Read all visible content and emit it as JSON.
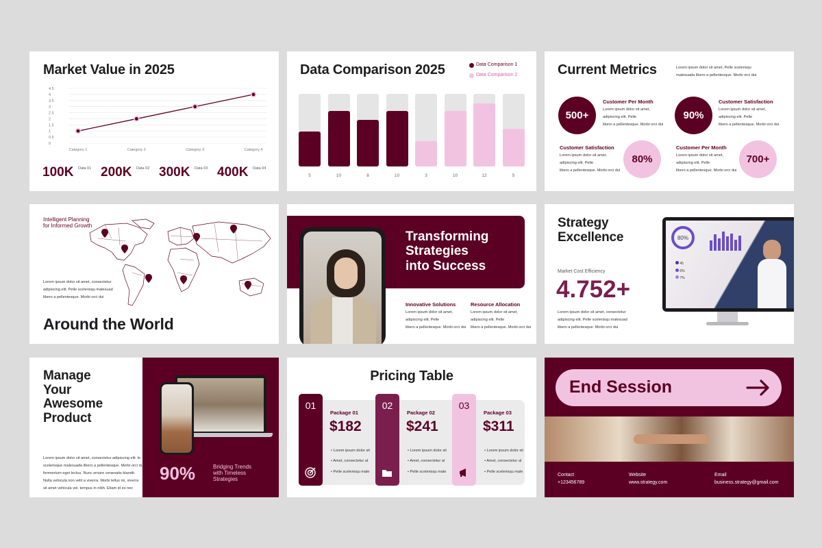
{
  "colors": {
    "wine": "#5b0022",
    "pink": "#f1c3e1",
    "gray_bar": "#e5e5e6",
    "plum": "#7a1e4e",
    "background": "#dcdcdc"
  },
  "lorem": {
    "a": "Lorem ipsum dolor sit amet, consectetur",
    "b": "adipiscing elit. Pelle scelerisqu malesuad",
    "c": "libero a pellentesque. Morbi orci dui",
    "short1": "Lorem ipsum dolor sit amet,",
    "short2": "adipiscing elit. Pelle",
    "short3": "scelerisque malesuada",
    "short4": "libero a pellentesque. Morbi orci dui"
  },
  "slide1": {
    "title": "Market Value in 2025",
    "chart_data": {
      "type": "line",
      "categories": [
        "Category 1",
        "Category 2",
        "Category 3",
        "Category 4"
      ],
      "values": [
        1,
        2,
        3,
        4
      ],
      "ylim": [
        0,
        4.5
      ],
      "yticks": [
        "0",
        "0.5",
        "1",
        "1.5",
        "2",
        "2.5",
        "3",
        "3.5",
        "4",
        "4.5"
      ],
      "grid": true,
      "color": "#5b0022",
      "marker_color": "#f1c3e1"
    },
    "stats": [
      {
        "value": "100K",
        "label": "Data 01"
      },
      {
        "value": "200K",
        "label": "Data 02"
      },
      {
        "value": "300K",
        "label": "Data 03"
      },
      {
        "value": "400K",
        "label": "Data 04"
      }
    ]
  },
  "slide2": {
    "title": "Data Comparison 2025",
    "legend": [
      "Data Comparison 1",
      "Data Comparison 2"
    ],
    "chart_data": {
      "type": "bar",
      "categories": [
        "5",
        "10",
        "8",
        "10",
        "3",
        "10",
        "12",
        "5"
      ],
      "series": [
        {
          "name": "Data Comparison 1",
          "indices": [
            0,
            1,
            2,
            3
          ],
          "color": "#5b0022"
        },
        {
          "name": "Data Comparison 2",
          "indices": [
            4,
            5,
            6,
            7
          ],
          "color": "#f1c3e1"
        }
      ],
      "fill_fraction": [
        0.48,
        0.76,
        0.64,
        0.76,
        0.35,
        0.76,
        0.87,
        0.52
      ],
      "track_color": "#e5e5e6"
    }
  },
  "slide3": {
    "title": "Current Metrics",
    "intro": [
      "Lorem ipsum dolor sit amet, Pelle scelerisqu",
      "malesuada libero a pellentesque. Morbi orci dui"
    ],
    "metrics": [
      {
        "value": "500+",
        "label": "Customer Per Month"
      },
      {
        "value": "90%",
        "label": "Customer Satisfaction"
      },
      {
        "value": "80%",
        "label": "Customer Satisfaction"
      },
      {
        "value": "700+",
        "label": "Customer Per Month"
      }
    ]
  },
  "slide4": {
    "tagline": [
      "Intelligent Planning",
      "for Informed Growth"
    ],
    "title": "Around the World",
    "pin_icon": "map-pin-icon"
  },
  "slide5": {
    "headline": [
      "Transforming",
      "Strategies",
      "into Success"
    ],
    "col1_title": "Innovative Solutions",
    "col2_title": "Resource Allocation"
  },
  "slide6": {
    "title": [
      "Strategy",
      "Excellence"
    ],
    "stat_label": "Market Cost Efficiency",
    "stat_value": "4.752+",
    "screen_percent": "80%",
    "screen_rows": [
      "45",
      "6%",
      "7%"
    ]
  },
  "slide7": {
    "title": [
      "Manage",
      "Your",
      "Awesome",
      "Product"
    ],
    "body": [
      "Lorem ipsum dolor sit amet, consectetur adipiscing elit. le",
      "scelerisque malesuada libero a pellentesque. Morbi orci dui",
      "fermentum eget lectus. Nunc ornare venenatis blandit.",
      "Nulla vehicula non velit a viverra. Morbi tellus mi, viverra",
      "sit amet vehicula vel, tempus in nibh. Etiam id ex nec"
    ],
    "stat_value": "90%",
    "stat_label": [
      "Bridging Trends",
      "with Timeless",
      "Strategies"
    ]
  },
  "slide8": {
    "title": "Pricing Table",
    "packages": [
      {
        "num": "01",
        "name": "Package 01",
        "price": "$182",
        "icon": "target-icon"
      },
      {
        "num": "02",
        "name": "Package 02",
        "price": "$241",
        "icon": "folder-icon"
      },
      {
        "num": "03",
        "name": "Package 03",
        "price": "$311",
        "icon": "megaphone-icon"
      }
    ],
    "bullets": [
      "Lorem ipsum dolor sit",
      "Amet, consectetur al",
      "Pelle scelerisqu male"
    ]
  },
  "slide9": {
    "button_label": "End Session",
    "arrow_icon": "arrow-right-icon",
    "contact_label": "Contact",
    "contact_value": "+123456789",
    "website_label": "Website",
    "website_value": "www.strategy.com",
    "email_label": "Email",
    "email_value": "business.strategy@gmail.com"
  }
}
